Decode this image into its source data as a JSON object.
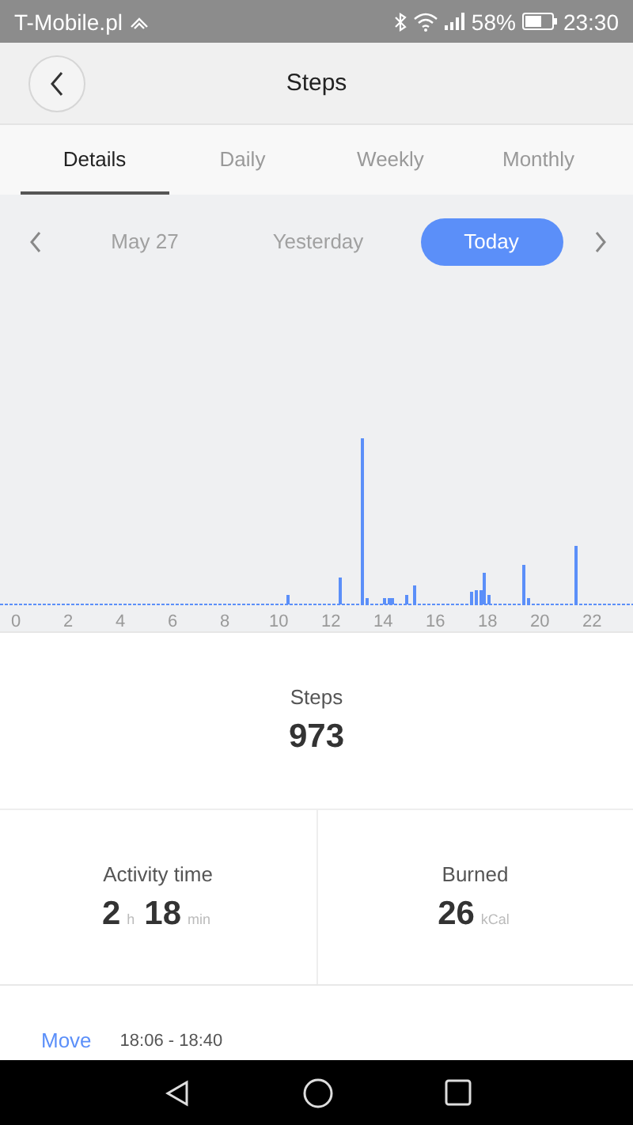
{
  "status_bar": {
    "carrier": "T-Mobile.pl",
    "battery": "58%",
    "time": "23:30"
  },
  "header": {
    "title": "Steps"
  },
  "tabs": [
    {
      "label": "Details",
      "selected": true
    },
    {
      "label": "Daily",
      "selected": false
    },
    {
      "label": "Weekly",
      "selected": false
    },
    {
      "label": "Monthly",
      "selected": false
    }
  ],
  "dates": [
    {
      "label": "May 27",
      "selected": false
    },
    {
      "label": "Yesterday",
      "selected": false
    },
    {
      "label": "Today",
      "selected": true
    }
  ],
  "chart": {
    "x_labels": [
      "0",
      "2",
      "4",
      "6",
      "8",
      "10",
      "12",
      "14",
      "16",
      "18",
      "20",
      "22"
    ]
  },
  "summary": {
    "label": "Steps",
    "value": "973"
  },
  "stats": [
    {
      "label": "Activity time",
      "parts": [
        {
          "value": "2",
          "unit": "h"
        },
        {
          "value": "18",
          "unit": "min"
        }
      ]
    },
    {
      "label": "Burned",
      "parts": [
        {
          "value": "26",
          "unit": "kCal"
        }
      ]
    }
  ],
  "activities": [
    {
      "type": "Move",
      "time": "18:06 - 18:40"
    }
  ]
}
